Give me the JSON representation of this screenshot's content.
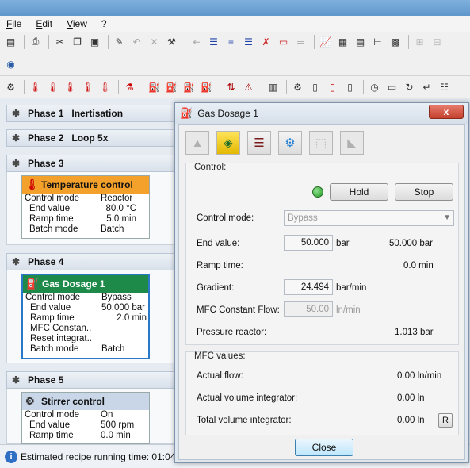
{
  "menu": [
    "File",
    "Edit",
    "View",
    "?"
  ],
  "phases": [
    {
      "label": "Phase 1",
      "title": "Inertisation"
    },
    {
      "label": "Phase 2",
      "title": "Loop 5x"
    },
    {
      "label": "Phase 3",
      "title": ""
    },
    {
      "label": "Phase 4",
      "title": ""
    },
    {
      "label": "Phase 5",
      "title": ""
    }
  ],
  "cards": {
    "temperature": {
      "title": "Temperature control",
      "color": "#f4a12b",
      "rows": [
        {
          "k": "Control mode",
          "v": "Reactor"
        },
        {
          "k": "End value",
          "v": "80.0 °C"
        },
        {
          "k": "Ramp time",
          "v": "5.0 min"
        },
        {
          "k": "Batch mode",
          "v": "Batch"
        }
      ]
    },
    "gas": {
      "title": "Gas Dosage 1",
      "color": "#1e8a4a",
      "rows": [
        {
          "k": "Control mode",
          "v": "Bypass"
        },
        {
          "k": "End value",
          "v": "50.000 bar"
        },
        {
          "k": "Ramp time",
          "v": "2.0 min"
        },
        {
          "k": "MFC Constan..",
          "v": ""
        },
        {
          "k": "Reset integrat..",
          "v": ""
        },
        {
          "k": "Batch mode",
          "v": "Batch"
        }
      ]
    },
    "stirrer": {
      "title": "Stirrer control",
      "color": "#c9d6e8",
      "rows": [
        {
          "k": "Control mode",
          "v": "On"
        },
        {
          "k": "End value",
          "v": "500 rpm"
        },
        {
          "k": "Ramp time",
          "v": "0.0 min"
        }
      ]
    }
  },
  "status": {
    "text": "Estimated recipe running time: 01:04:"
  },
  "dialog": {
    "title": "Gas Dosage 1",
    "close_x": "x",
    "control_label": "Control:",
    "hold": "Hold",
    "stop": "Stop",
    "control_mode_label": "Control mode:",
    "control_mode_value": "Bypass",
    "end_value_label": "End value:",
    "end_value": "50.000",
    "end_value_unit": "bar",
    "end_value_actual": "50.000 bar",
    "ramp_time_label": "Ramp time:",
    "ramp_time_actual": "0.0 min",
    "gradient_label": "Gradient:",
    "gradient_value": "24.494",
    "gradient_unit": "bar/min",
    "mfc_label": "MFC Constant Flow:",
    "mfc_value": "50.00",
    "mfc_unit": "ln/min",
    "pressure_label": "Pressure reactor:",
    "pressure_value": "1.013 bar",
    "mfc_values_label": "MFC values:",
    "actual_flow_label": "Actual flow:",
    "actual_flow_value": "0.00 ln/min",
    "actual_vol_label": "Actual volume integrator:",
    "actual_vol_value": "0.00 ln",
    "total_vol_label": "Total volume integrator:",
    "total_vol_value": "0.00 ln",
    "reset_btn": "R",
    "close_btn": "Close"
  }
}
